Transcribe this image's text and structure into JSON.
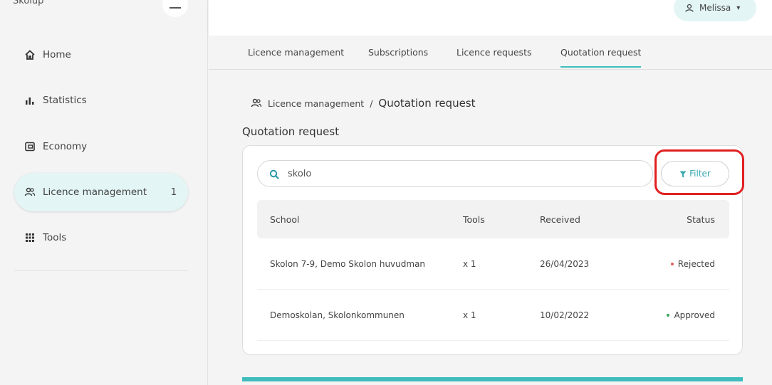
{
  "sidebar": {
    "brand": "Skolup",
    "items": [
      {
        "label": "Home",
        "icon": "home-icon"
      },
      {
        "label": "Statistics",
        "icon": "bar-chart-icon"
      },
      {
        "label": "Economy",
        "icon": "wallet-icon"
      },
      {
        "label": "Licence management",
        "icon": "users-icon",
        "badge": "1"
      },
      {
        "label": "Tools",
        "icon": "grid-icon"
      }
    ]
  },
  "topbar": {
    "user": "Melissa"
  },
  "tabs": [
    {
      "label": "Licence management"
    },
    {
      "label": "Subscriptions"
    },
    {
      "label": "Licence requests"
    },
    {
      "label": "Quotation request"
    }
  ],
  "breadcrumb": {
    "parent": "Licence management",
    "separator": "/",
    "current": "Quotation request"
  },
  "page_title": "Quotation request",
  "search": {
    "value": "skolo"
  },
  "filter_label": "Filter",
  "table": {
    "headers": {
      "school": "School",
      "tools": "Tools",
      "received": "Received",
      "status": "Status"
    },
    "rows": [
      {
        "school": "Skolon 7-9, Demo Skolon huvudman",
        "tools": "x 1",
        "received": "26/04/2023",
        "status": "Rejected",
        "status_color": "#e06060"
      },
      {
        "school": "Demoskolan, Skolonkommunen",
        "tools": "x 1",
        "received": "10/02/2022",
        "status": "Approved",
        "status_color": "#3aa860"
      }
    ]
  },
  "colors": {
    "accent": "#3fbcbc",
    "highlight": "#e02020"
  }
}
